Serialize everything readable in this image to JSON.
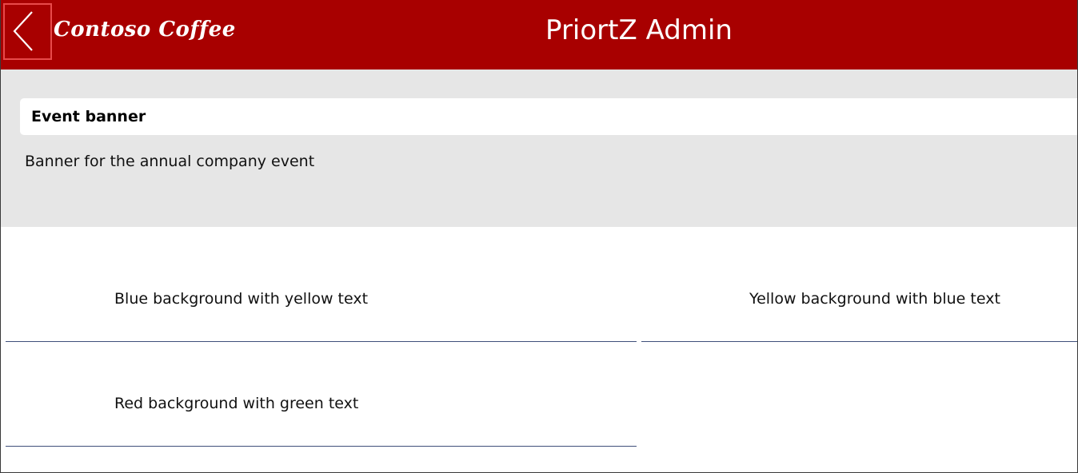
{
  "header": {
    "logo_text": "Contoso Coffee",
    "title": "PriortZ Admin",
    "back_icon": "chevron-left-icon",
    "background_color": "#a80000"
  },
  "banner": {
    "title": "Event banner",
    "description": "Banner for the annual company event"
  },
  "gallery": {
    "items": [
      {
        "label": "Blue background with yellow text"
      },
      {
        "label": "Yellow background with blue text"
      },
      {
        "label": "Red background with green text"
      }
    ],
    "separator_color": "#3f4f7a"
  }
}
